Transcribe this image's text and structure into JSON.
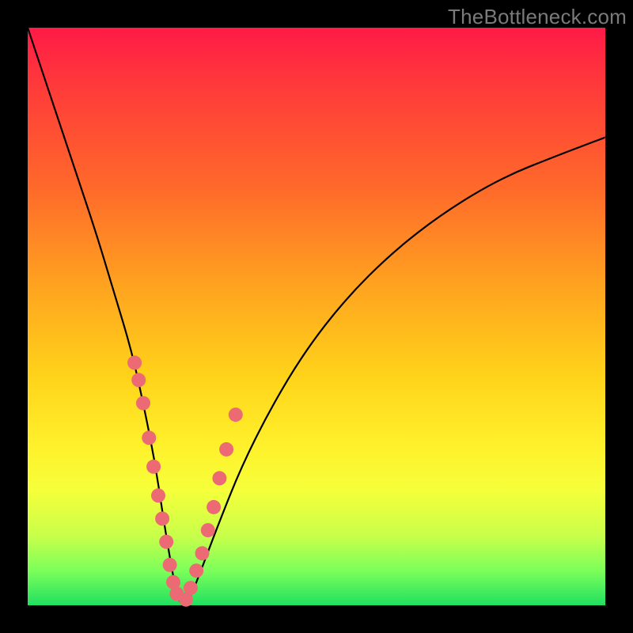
{
  "watermark": "TheBottleneck.com",
  "colors": {
    "frame": "#000000",
    "gradient_top": "#ff1a47",
    "gradient_mid": "#ffd21a",
    "gradient_bottom": "#20e060",
    "curve": "#000000",
    "marker": "#ec6a74"
  },
  "chart_data": {
    "type": "line",
    "title": "",
    "xlabel": "",
    "ylabel": "",
    "xlim": [
      0,
      100
    ],
    "ylim": [
      0,
      100
    ],
    "series": [
      {
        "name": "bottleneck-curve",
        "x": [
          0,
          4,
          8,
          12,
          15,
          18,
          20,
          22,
          23.5,
          25,
          26,
          27,
          28,
          30,
          33,
          37,
          42,
          48,
          55,
          63,
          72,
          82,
          92,
          100
        ],
        "y": [
          100,
          88,
          76,
          64,
          54,
          44,
          35,
          25,
          15,
          6,
          1,
          0,
          1,
          6,
          14,
          24,
          34,
          44,
          53,
          61,
          68,
          74,
          78,
          81
        ]
      }
    ],
    "markers": {
      "name": "highlighted-points",
      "x": [
        18.5,
        19.2,
        20.0,
        21.0,
        21.8,
        22.6,
        23.3,
        24.0,
        24.6,
        25.2,
        25.8,
        27.4,
        28.2,
        29.2,
        30.2,
        31.2,
        32.2,
        33.2,
        34.4,
        36.0
      ],
      "y": [
        42,
        39,
        35,
        29,
        24,
        19,
        15,
        11,
        7,
        4,
        2,
        1,
        3,
        6,
        9,
        13,
        17,
        22,
        27,
        33
      ]
    },
    "annotations": [
      {
        "text": "TheBottleneck.com",
        "position": "top-right"
      }
    ]
  }
}
